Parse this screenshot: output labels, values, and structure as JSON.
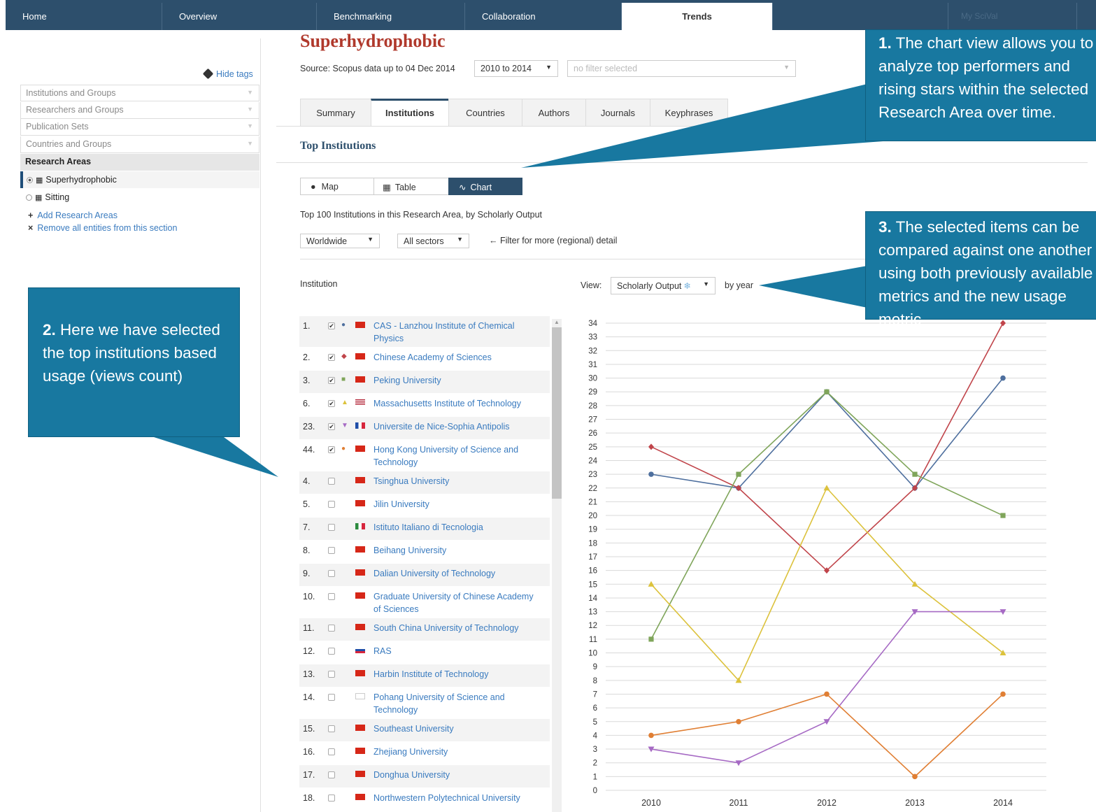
{
  "nav": {
    "tabs": [
      "Home",
      "Overview",
      "Benchmarking",
      "Collaboration",
      "Trends"
    ],
    "active": "Trends",
    "myscival": "My SciVal"
  },
  "sidebar": {
    "hide_tags": "Hide tags",
    "sections": [
      "Institutions and Groups",
      "Researchers and Groups",
      "Publication Sets",
      "Countries and Groups"
    ],
    "research_header": "Research Areas",
    "areas": [
      "Superhydrophobic",
      "Sitting"
    ],
    "add_link": "Add Research Areas",
    "remove_link": "Remove all entities from this section"
  },
  "header": {
    "title": "Superhydrophobic",
    "source": "Source: Scopus data up to 04 Dec 2014",
    "year_range": "2010 to 2014",
    "filter_placeholder": "no filter selected"
  },
  "tabs": [
    "Summary",
    "Institutions",
    "Countries",
    "Authors",
    "Journals",
    "Keyphrases"
  ],
  "section": {
    "title": "Top Institutions",
    "views": [
      "Map",
      "Table",
      "Chart"
    ],
    "subtitle": "Top 100 Institutions in this Research Area, by Scholarly Output",
    "region": "Worldwide",
    "sector": "All sectors",
    "filter_hint": "← Filter for more (regional) detail",
    "institution_label": "Institution",
    "view_label": "View:",
    "metric": "Scholarly Output",
    "by_year": "by year"
  },
  "institutions": [
    {
      "rank": "1.",
      "name": "CAS - Lanzhou Institute of Chemical Physics",
      "checked": true,
      "marker": "●",
      "color": "#4e6f9e",
      "flag": "cn"
    },
    {
      "rank": "2.",
      "name": "Chinese Academy of Sciences",
      "checked": true,
      "marker": "◆",
      "color": "#c0444a",
      "flag": "cn"
    },
    {
      "rank": "3.",
      "name": "Peking University",
      "checked": true,
      "marker": "■",
      "color": "#7fa55a",
      "flag": "cn"
    },
    {
      "rank": "6.",
      "name": "Massachusetts Institute of Technology",
      "checked": true,
      "marker": "▲",
      "color": "#dcc23c",
      "flag": "us"
    },
    {
      "rank": "23.",
      "name": "Universite de Nice-Sophia Antipolis",
      "checked": true,
      "marker": "▼",
      "color": "#a66ac4",
      "flag": "fr"
    },
    {
      "rank": "44.",
      "name": "Hong Kong University of Science and Technology",
      "checked": true,
      "marker": "●",
      "color": "#e07f34",
      "flag": "hk"
    },
    {
      "rank": "4.",
      "name": "Tsinghua University",
      "checked": false,
      "flag": "cn"
    },
    {
      "rank": "5.",
      "name": "Jilin University",
      "checked": false,
      "flag": "cn"
    },
    {
      "rank": "7.",
      "name": "Istituto Italiano di Tecnologia",
      "checked": false,
      "flag": "it"
    },
    {
      "rank": "8.",
      "name": "Beihang University",
      "checked": false,
      "flag": "cn"
    },
    {
      "rank": "9.",
      "name": "Dalian University of Technology",
      "checked": false,
      "flag": "cn"
    },
    {
      "rank": "10.",
      "name": "Graduate University of Chinese Academy of Sciences",
      "checked": false,
      "flag": "cn"
    },
    {
      "rank": "11.",
      "name": "South China University of Technology",
      "checked": false,
      "flag": "cn"
    },
    {
      "rank": "12.",
      "name": "RAS",
      "checked": false,
      "flag": "ru"
    },
    {
      "rank": "13.",
      "name": "Harbin Institute of Technology",
      "checked": false,
      "flag": "cn"
    },
    {
      "rank": "14.",
      "name": "Pohang University of Science and Technology",
      "checked": false,
      "flag": "kr"
    },
    {
      "rank": "15.",
      "name": "Southeast University",
      "checked": false,
      "flag": "cn"
    },
    {
      "rank": "16.",
      "name": "Zhejiang University",
      "checked": false,
      "flag": "cn"
    },
    {
      "rank": "17.",
      "name": "Donghua University",
      "checked": false,
      "flag": "cn"
    },
    {
      "rank": "18.",
      "name": "Northwestern Polytechnical University",
      "checked": false,
      "flag": "cn"
    }
  ],
  "chart_data": {
    "type": "line",
    "x": [
      2010,
      2011,
      2012,
      2013,
      2014
    ],
    "ylim": [
      0,
      34
    ],
    "yticks": [
      0,
      1,
      2,
      3,
      4,
      5,
      6,
      7,
      8,
      9,
      10,
      11,
      12,
      13,
      14,
      15,
      16,
      17,
      18,
      19,
      20,
      21,
      22,
      23,
      24,
      25,
      26,
      27,
      28,
      29,
      30,
      31,
      32,
      33,
      34
    ],
    "grid": true,
    "series": [
      {
        "name": "CAS - Lanzhou Institute of Chemical Physics",
        "color": "#4e6f9e",
        "marker": "circle",
        "values": [
          23,
          22,
          29,
          22,
          30
        ]
      },
      {
        "name": "Chinese Academy of Sciences",
        "color": "#c0444a",
        "marker": "diamond",
        "values": [
          25,
          22,
          16,
          22,
          34
        ]
      },
      {
        "name": "Peking University",
        "color": "#7fa55a",
        "marker": "square",
        "values": [
          11,
          23,
          29,
          23,
          20
        ]
      },
      {
        "name": "Massachusetts Institute of Technology",
        "color": "#dcc23c",
        "marker": "triangle",
        "values": [
          15,
          8,
          22,
          15,
          10
        ]
      },
      {
        "name": "Universite de Nice-Sophia Antipolis",
        "color": "#a66ac4",
        "marker": "triangle-down",
        "values": [
          3,
          2,
          5,
          13,
          13
        ]
      },
      {
        "name": "Hong Kong University of Science and Technology",
        "color": "#e07f34",
        "marker": "circle",
        "values": [
          4,
          5,
          7,
          1,
          7
        ]
      }
    ]
  },
  "callouts": {
    "c1_num": "1.",
    "c1_text": " The chart view allows you to analyze top performers and rising stars within the selected Research Area over time.",
    "c2_num": "2.",
    "c2_text": " Here we have selected the top institutions based usage (views count)",
    "c3_num": "3.",
    "c3_text": " The selected items can be compared against one another using both previously available metrics and the new usage metric"
  }
}
